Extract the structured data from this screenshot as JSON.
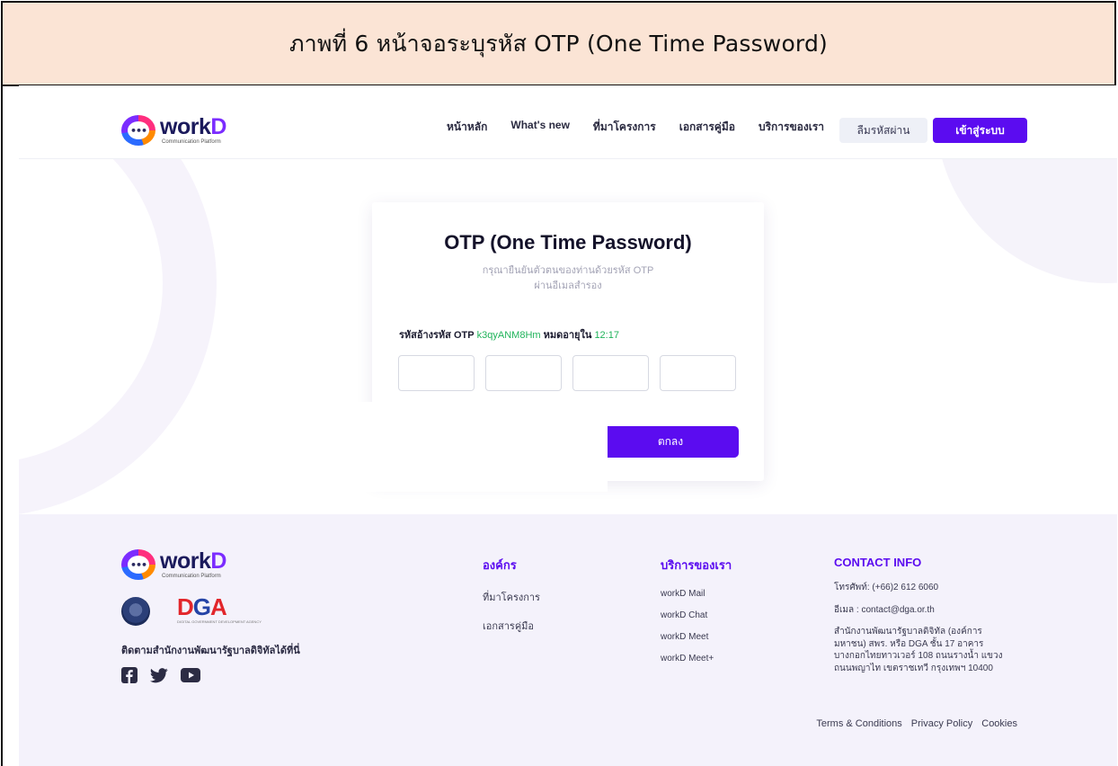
{
  "caption": "ภาพที่ 6 หน้าจอระบุรหัส OTP (One Time Password)",
  "brand": {
    "name_main": "work",
    "name_accent": "D",
    "tagline": "Communication Platform",
    "colors": {
      "primary": "#5b0cf0",
      "navy": "#1b1a5c",
      "success": "#1fb35a"
    }
  },
  "header": {
    "nav": [
      {
        "label": "หน้าหลัก"
      },
      {
        "label": "What's new"
      },
      {
        "label": "ที่มาโครงการ"
      },
      {
        "label": "เอกสารคู่มือ"
      },
      {
        "label": "บริการของเรา"
      }
    ],
    "forgot_label": "ลืมรหัสผ่าน",
    "login_label": "เข้าสู่ระบบ"
  },
  "otp": {
    "title": "OTP (One Time Password)",
    "subtitle_line1": "กรุณายืนยันตัวตนของท่านด้วยรหัส OTP",
    "subtitle_line2": "ผ่านอีเมลสำรอง",
    "ref_label": "รหัสอ้างรหัส OTP",
    "ref_code": "k3qyANM8Hm",
    "expire_label": "หมดอายุใน",
    "expire_time": "12:17",
    "boxes": 4,
    "submit_label": "ตกลง"
  },
  "footer": {
    "dga_text_d": "D",
    "dga_text_g": "G",
    "dga_text_a": "A",
    "dga_sub": "DIGITAL GOVERNMENT DEVELOPMENT AGENCY",
    "follow_text": "ติดตามสำนักงานพัฒนารัฐบาลดิจิทัลได้ที่นี่",
    "social_icons": [
      "facebook-icon",
      "twitter-icon",
      "youtube-icon"
    ],
    "org": {
      "title": "องค์กร",
      "items": [
        "ที่มาโครงการ",
        "เอกสารคู่มือ"
      ]
    },
    "services": {
      "title": "บริการของเรา",
      "items": [
        "workD Mail",
        "workD Chat",
        "workD Meet",
        "workD Meet+"
      ]
    },
    "contact": {
      "title": "CONTACT INFO",
      "phone": "โทรศัพท์: (+66)2 612 6060",
      "email": "อีเมล : contact@dga.or.th",
      "address_line1": "สำนักงานพัฒนารัฐบาลดิจิทัล (องค์การ",
      "address_line2": "มหาชน) สพร. หรือ DGA ชั้น 17 อาคาร",
      "address_line3": "บางกอกไทยทาวเวอร์ 108 ถนนรางน้ำ แขวง",
      "address_line4": "ถนนพญาไท เขตราชเทวี กรุงเทพฯ 10400"
    },
    "legal": [
      "Terms & Conditions",
      "Privacy Policy",
      "Cookies"
    ]
  }
}
